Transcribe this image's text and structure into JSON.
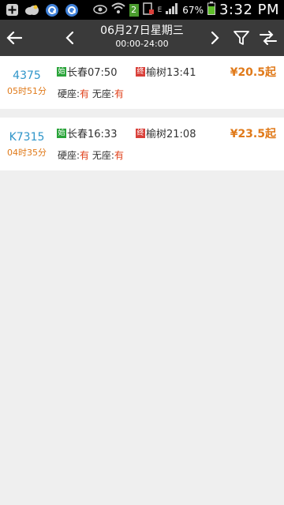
{
  "statusbar": {
    "battery_pct": "67%",
    "time": "3:32 PM",
    "sim_label": "2"
  },
  "header": {
    "date": "06月27日星期三",
    "time_range": "00:00-24:00"
  },
  "trains": [
    {
      "train_no": "4375",
      "duration": "05时51分",
      "start_tag": "始",
      "depart": "长春07:50",
      "end_tag": "终",
      "arrive": "榆树13:41",
      "price": "¥20.5起",
      "seat1_label": "硬座:",
      "seat1_status": "有",
      "seat2_label": "无座:",
      "seat2_status": "有"
    },
    {
      "train_no": "K7315",
      "duration": "04时35分",
      "start_tag": "始",
      "depart": "长春16:33",
      "end_tag": "终",
      "arrive": "榆树21:08",
      "price": "¥23.5起",
      "seat1_label": "硬座:",
      "seat1_status": "有",
      "seat2_label": "无座:",
      "seat2_status": "有"
    }
  ],
  "colors": {
    "accent_blue": "#2f95c9",
    "accent_orange": "#e07a1a",
    "available_red": "#e0401a",
    "appbar": "#3a3a3a"
  }
}
